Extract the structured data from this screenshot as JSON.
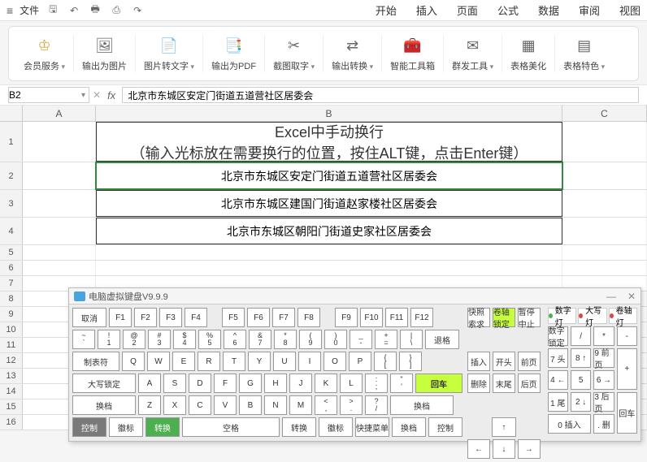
{
  "topbar": {
    "file": "文件",
    "tabs": [
      "开始",
      "插入",
      "页面",
      "公式",
      "数据",
      "审阅",
      "视图"
    ]
  },
  "ribbon": [
    {
      "icon": "crown",
      "label": "会员服务",
      "drop": true,
      "vip": true
    },
    {
      "icon": "image",
      "label": "输出为图片"
    },
    {
      "icon": "ocr",
      "label": "图片转文字",
      "drop": true
    },
    {
      "icon": "pdf",
      "label": "输出为PDF"
    },
    {
      "icon": "crop",
      "label": "截图取字",
      "drop": true
    },
    {
      "icon": "export",
      "label": "输出转换",
      "drop": true
    },
    {
      "icon": "tools",
      "label": "智能工具箱"
    },
    {
      "icon": "send",
      "label": "群发工具",
      "drop": true
    },
    {
      "icon": "table",
      "label": "表格美化"
    },
    {
      "icon": "feature",
      "label": "表格特色",
      "drop": true
    }
  ],
  "namebox": "B2",
  "formula": "北京市东城区安定门街道五道营社区居委会",
  "cols": [
    "A",
    "B",
    "C"
  ],
  "title_line1": "Excel中手动换行",
  "title_line2": "（输入光标放在需要换行的位置，按住ALT键，点击Enter键）",
  "cells": {
    "b2": "北京市东城区安定门街道五道营社区居委会",
    "b3": "北京市东城区建国门街道赵家楼社区居委会",
    "b4": "北京市东城区朝阳门街道史家社区居委会"
  },
  "kb": {
    "title": "电脑虚拟键盘V9.9.9",
    "cancel": "取消",
    "frow": [
      "F1",
      "F2",
      "F3",
      "F4",
      "F5",
      "F6",
      "F7",
      "F8",
      "F9",
      "F10",
      "F11",
      "F12"
    ],
    "side_top": [
      "快照索求",
      "卷轴锁定",
      "暂停中止"
    ],
    "side_mid": [
      [
        "插入",
        "开头",
        "前页"
      ],
      [
        "删除",
        "末尾",
        "后页"
      ]
    ],
    "indicators": [
      {
        "label": "数字灯",
        "on": true
      },
      {
        "label": "大写灯",
        "on": false
      },
      {
        "label": "卷轴灯",
        "on": false
      }
    ],
    "row2": [
      [
        "~",
        "`"
      ],
      [
        "!",
        "1"
      ],
      [
        "@",
        "2"
      ],
      [
        "#",
        "3"
      ],
      [
        "$",
        "4"
      ],
      [
        "%",
        "5"
      ],
      [
        "^",
        "6"
      ],
      [
        "&",
        "7"
      ],
      [
        "*",
        "8"
      ],
      [
        "(",
        "9"
      ],
      [
        ")",
        "0"
      ],
      [
        "_",
        "-"
      ],
      [
        "+",
        "="
      ],
      [
        "|",
        "\\"
      ]
    ],
    "row2_back": "退格",
    "tab": "制表符",
    "row3": [
      "Q",
      "W",
      "E",
      "R",
      "T",
      "Y",
      "U",
      "I",
      "O",
      "P",
      [
        "{",
        "["
      ],
      [
        "}",
        "]"
      ]
    ],
    "caps": "大写锁定",
    "row4": [
      "A",
      "S",
      "D",
      "F",
      "G",
      "H",
      "J",
      "K",
      "L",
      [
        ":",
        ";"
      ],
      [
        "\"",
        "'"
      ]
    ],
    "enter": "回车",
    "shift": "换档",
    "row5": [
      "Z",
      "X",
      "C",
      "V",
      "B",
      "N",
      "M",
      [
        "<",
        ","
      ],
      [
        ">",
        "."
      ],
      [
        "?",
        "/"
      ]
    ],
    "row6": [
      "控制",
      "徽标",
      "转换",
      "空格",
      "转换",
      "徽标",
      "快捷菜单",
      "换档",
      "控制"
    ],
    "numpad": {
      "lock": "数字锁定",
      "keys": [
        "/",
        "*",
        "-",
        "7\n头",
        "8\n↑",
        "9\n前页",
        "+",
        "4\n←",
        "5",
        "6\n→",
        "1\n尾",
        "2\n↓",
        "3\n后页",
        "回车",
        "0\n插入",
        ".\n删"
      ]
    }
  }
}
